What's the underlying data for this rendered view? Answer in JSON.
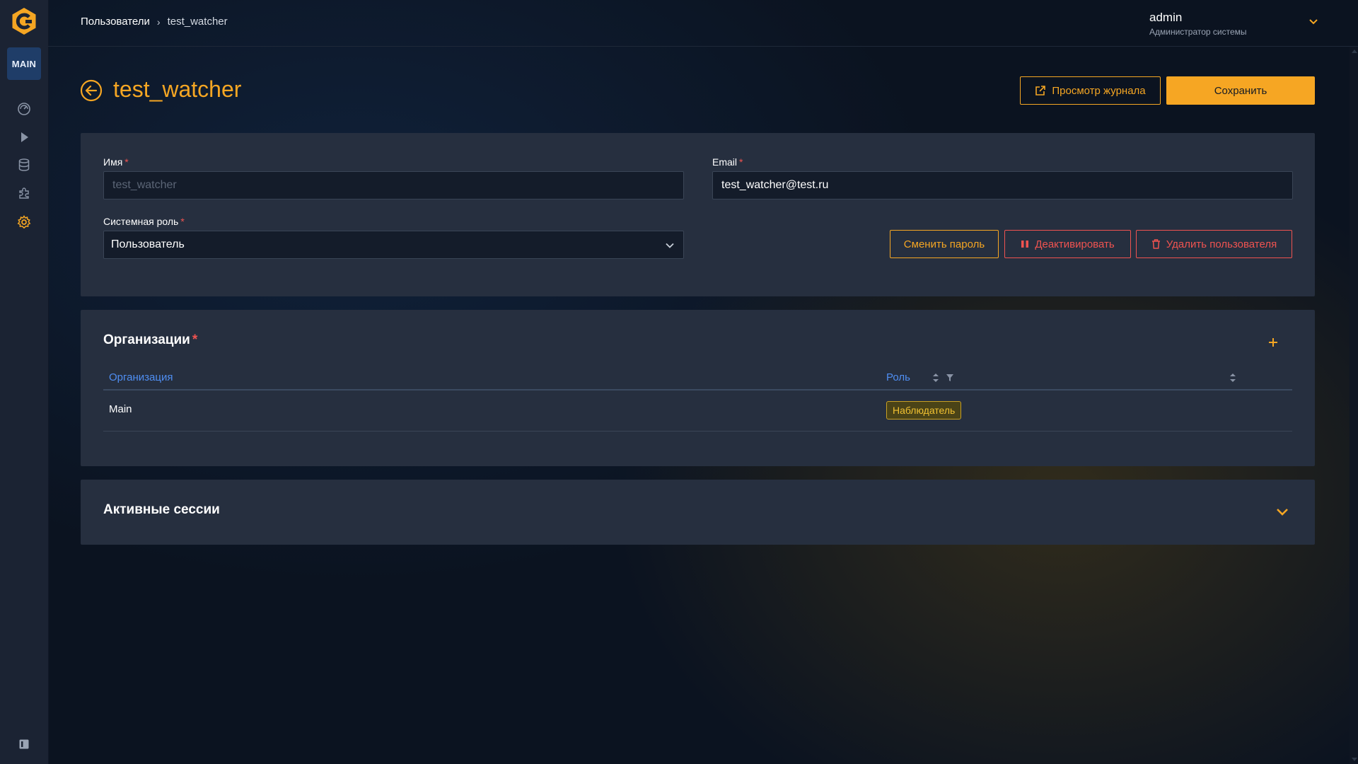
{
  "sidebar": {
    "workspace_label": "MAIN",
    "icons": [
      "dashboard-icon",
      "play-icon",
      "database-icon",
      "plugin-icon",
      "settings-icon"
    ],
    "accent": "#f5a623"
  },
  "breadcrumb": {
    "parent": "Пользователи",
    "current": "test_watcher"
  },
  "user": {
    "name": "admin",
    "role": "Администратор системы"
  },
  "page": {
    "title": "test_watcher",
    "log_button": "Просмотр журнала",
    "save_button": "Сохранить"
  },
  "form": {
    "name_label": "Имя",
    "name_value": "test_watcher",
    "email_label": "Email",
    "email_value": "test_watcher@test.ru",
    "role_label": "Системная роль",
    "role_value": "Пользователь",
    "required_mark": "*",
    "change_password": "Сменить пароль",
    "deactivate": "Деактивировать",
    "delete_user": "Удалить пользователя"
  },
  "orgs": {
    "title": "Организации",
    "columns": [
      "Организация",
      "Роль"
    ],
    "rows": [
      {
        "organization": "Main",
        "role": "Наблюдатель"
      }
    ]
  },
  "sessions": {
    "title": "Активные сессии"
  },
  "colors": {
    "accent": "#f5a623",
    "danger": "#ef5350",
    "link": "#4f8ef2"
  }
}
